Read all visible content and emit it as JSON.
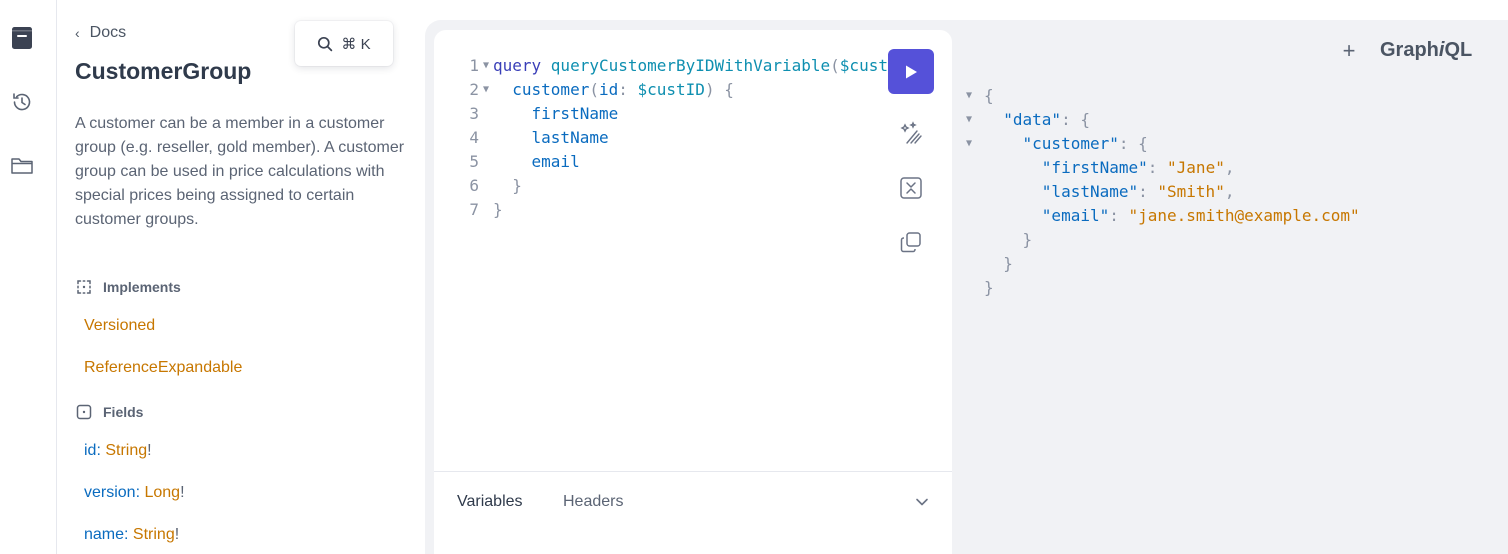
{
  "sidebar": {
    "icons": [
      "docs-icon",
      "history-icon",
      "folder-icon"
    ]
  },
  "docs": {
    "back_label": "Docs",
    "search_shortcut": "⌘ K",
    "type_name": "CustomerGroup",
    "description": "A customer can be a member in a customer group (e.g. reseller, gold member). A customer group can be used in price calculations with special prices being assigned to certain customer groups.",
    "implements_heading": "Implements",
    "interfaces": [
      "Versioned",
      "ReferenceExpandable"
    ],
    "fields_heading": "Fields",
    "fields": [
      {
        "name": "id",
        "type": "String",
        "suffix": "!"
      },
      {
        "name": "version",
        "type": "Long",
        "suffix": "!"
      },
      {
        "name": "name",
        "type": "String",
        "suffix": "!"
      }
    ]
  },
  "editor": {
    "lines": [
      {
        "n": "1",
        "fold": "▼",
        "tokens": [
          [
            "kw",
            "query "
          ],
          [
            "fn",
            "queryCustomerByIDWithVariable"
          ],
          [
            "punc",
            "("
          ],
          [
            "var",
            "$custID: String"
          ]
        ]
      },
      {
        "n": "2",
        "fold": "▼",
        "tokens": [
          [
            "fld",
            "  customer"
          ],
          [
            "punc",
            "("
          ],
          [
            "fld",
            "id"
          ],
          [
            "punc",
            ": "
          ],
          [
            "var",
            "$custID"
          ],
          [
            "punc",
            ") {"
          ]
        ]
      },
      {
        "n": "3",
        "fold": "",
        "tokens": [
          [
            "fld",
            "    firstName"
          ]
        ]
      },
      {
        "n": "4",
        "fold": "",
        "tokens": [
          [
            "fld",
            "    lastName"
          ]
        ]
      },
      {
        "n": "5",
        "fold": "",
        "tokens": [
          [
            "fld",
            "    email"
          ]
        ]
      },
      {
        "n": "6",
        "fold": "",
        "tokens": [
          [
            "punc",
            "  }"
          ]
        ]
      },
      {
        "n": "7",
        "fold": "",
        "tokens": [
          [
            "punc",
            "}"
          ]
        ]
      }
    ]
  },
  "bottom_tabs": {
    "variables": "Variables",
    "headers": "Headers"
  },
  "header": {
    "plus": "+",
    "logo_pre": "Graph",
    "logo_i": "i",
    "logo_post": "QL"
  },
  "result": {
    "lines": [
      {
        "fold": "▼",
        "tokens": [
          [
            "rp",
            "{"
          ]
        ]
      },
      {
        "fold": "▼",
        "tokens": [
          [
            "rp",
            "  "
          ],
          [
            "rkey",
            "\"data\""
          ],
          [
            "rp",
            ": {"
          ]
        ]
      },
      {
        "fold": "▼",
        "tokens": [
          [
            "rp",
            "    "
          ],
          [
            "rkey",
            "\"customer\""
          ],
          [
            "rp",
            ": {"
          ]
        ]
      },
      {
        "fold": "",
        "tokens": [
          [
            "rp",
            "      "
          ],
          [
            "rkey",
            "\"firstName\""
          ],
          [
            "rp",
            ": "
          ],
          [
            "rstr",
            "\"Jane\""
          ],
          [
            "rp",
            ","
          ]
        ]
      },
      {
        "fold": "",
        "tokens": [
          [
            "rp",
            "      "
          ],
          [
            "rkey",
            "\"lastName\""
          ],
          [
            "rp",
            ": "
          ],
          [
            "rstr",
            "\"Smith\""
          ],
          [
            "rp",
            ","
          ]
        ]
      },
      {
        "fold": "",
        "tokens": [
          [
            "rp",
            "      "
          ],
          [
            "rkey",
            "\"email\""
          ],
          [
            "rp",
            ": "
          ],
          [
            "rstr",
            "\"jane.smith@example.com\""
          ]
        ]
      },
      {
        "fold": "",
        "tokens": [
          [
            "rp",
            "    }"
          ]
        ]
      },
      {
        "fold": "",
        "tokens": [
          [
            "rp",
            "  }"
          ]
        ]
      },
      {
        "fold": "",
        "tokens": [
          [
            "rp",
            "}"
          ]
        ]
      }
    ]
  },
  "colors": {
    "accent": "#5551d9",
    "field_blue": "#0a6bbf",
    "type_orange": "#c77700"
  }
}
